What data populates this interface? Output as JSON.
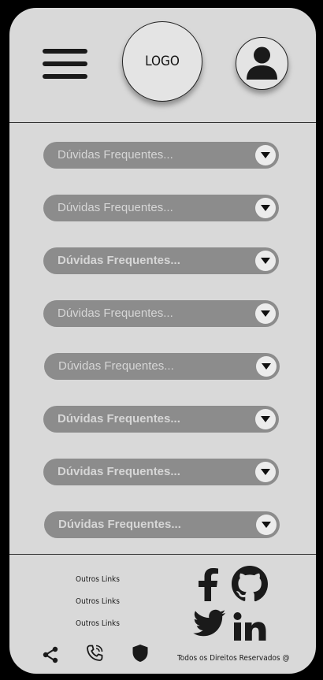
{
  "header": {
    "logo_text": "LOGO",
    "menu_icon": "hamburger-menu-icon",
    "profile_icon": "user-icon"
  },
  "faq": {
    "items": [
      {
        "label": "Dúvidas Frequentes...",
        "bold": false
      },
      {
        "label": "Dúvidas Frequentes...",
        "bold": false
      },
      {
        "label": "Dúvidas Frequentes...",
        "bold": true
      },
      {
        "label": "Dúvidas Frequentes...",
        "bold": false
      },
      {
        "label": "Dúvidas Frequentes...",
        "bold": false
      },
      {
        "label": "Dúvidas Frequentes...",
        "bold": true
      },
      {
        "label": "Dúvidas Frequentes...",
        "bold": true
      },
      {
        "label": "Dúvidas Frequentes...",
        "bold": true
      }
    ],
    "toggle_icon": "caret-down-icon"
  },
  "footer": {
    "links": [
      "Outros Links",
      "Outros Links",
      "Outros Links"
    ],
    "social_icons": [
      "facebook-icon",
      "github-icon",
      "twitter-icon",
      "linkedin-icon"
    ],
    "bottom_icons": [
      "share-icon",
      "phone-icon",
      "shield-icon"
    ],
    "rights": "Todos os Direitos Reservados @"
  },
  "colors": {
    "background": "#000000",
    "surface": "#d9d9d9",
    "pill": "#8c8c8c",
    "pill_text": "#d6d6d6",
    "dark": "#1a1a1a"
  }
}
